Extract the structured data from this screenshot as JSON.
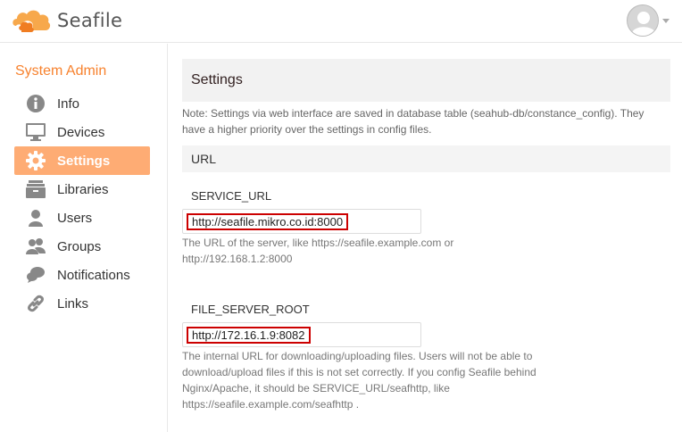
{
  "header": {
    "brand": "Seafile",
    "brand_color": "#f7822e"
  },
  "sidebar": {
    "title": "System Admin",
    "items": [
      {
        "label": "Info",
        "icon": "info-icon",
        "active": false
      },
      {
        "label": "Devices",
        "icon": "monitor-icon",
        "active": false
      },
      {
        "label": "Settings",
        "icon": "gear-icon",
        "active": true
      },
      {
        "label": "Libraries",
        "icon": "library-icon",
        "active": false
      },
      {
        "label": "Users",
        "icon": "user-icon",
        "active": false
      },
      {
        "label": "Groups",
        "icon": "group-icon",
        "active": false
      },
      {
        "label": "Notifications",
        "icon": "chat-bubble-icon",
        "active": false
      },
      {
        "label": "Links",
        "icon": "link-icon",
        "active": false
      }
    ]
  },
  "main": {
    "title": "Settings",
    "note": "Note: Settings via web interface are saved in database table (seahub-db/constance_config). They have a higher priority over the settings in config files.",
    "group_title": "URL",
    "settings": [
      {
        "name": "SERVICE_URL",
        "value": "http://seafile.mikro.co.id:8000",
        "help": "The URL of the server, like https://seafile.example.com or http://192.168.1.2:8000"
      },
      {
        "name": "FILE_SERVER_ROOT",
        "value": "http://172.16.1.9:8082",
        "help": "The internal URL for downloading/uploading files. Users will not be able to download/upload files if this is not set correctly. If you config Seafile behind Nginx/Apache, it should be SERVICE_URL/seafhttp, like https://seafile.example.com/seafhttp ."
      }
    ]
  },
  "colors": {
    "accent": "#f7822e",
    "active_nav_bg": "#feac74",
    "highlight_border": "#cc0000"
  }
}
